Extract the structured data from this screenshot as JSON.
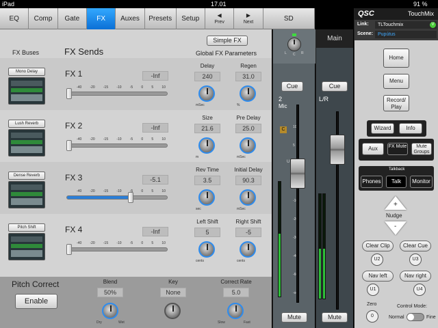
{
  "status": {
    "device": "iPad",
    "time": "17.01",
    "battery": "91 %"
  },
  "tabs": [
    {
      "label": "EQ"
    },
    {
      "label": "Comp"
    },
    {
      "label": "Gate"
    },
    {
      "label": "FX"
    },
    {
      "label": "Auxes"
    },
    {
      "label": "Presets"
    },
    {
      "label": "Setup"
    },
    {
      "label": "Prev"
    },
    {
      "label": "Next"
    },
    {
      "label": "SD"
    }
  ],
  "fx": {
    "buses_label": "FX Buses",
    "title": "FX Sends",
    "simple_fx_label": "Simple FX",
    "global_params_label": "Global FX Parameters",
    "scale": [
      "-40",
      "-20",
      "-15",
      "-10",
      "-5",
      "0",
      "5",
      "10"
    ],
    "rows": [
      {
        "name": "FX 1",
        "preset": "Mono Delay",
        "send": "-Inf",
        "send_level": 0.0,
        "p1_label": "Delay",
        "p1_value": "240",
        "p1_unit": "mSec",
        "p2_label": "Regen",
        "p2_value": "31.0",
        "p2_unit": "%"
      },
      {
        "name": "FX 2",
        "preset": "Lush Reverb",
        "send": "-Inf",
        "send_level": 0.0,
        "p1_label": "Size",
        "p1_value": "21.6",
        "p1_unit": "m",
        "p2_label": "Pre Delay",
        "p2_value": "25.0",
        "p2_unit": "mSec"
      },
      {
        "name": "FX 3",
        "preset": "Dense Reverb",
        "send": "-5.1",
        "send_level": 0.64,
        "p1_label": "Rev Time",
        "p1_value": "3.5",
        "p1_unit": "sec",
        "p2_label": "Initial Delay",
        "p2_value": "90.3",
        "p2_unit": "mSec"
      },
      {
        "name": "FX 4",
        "preset": "Pitch Shift",
        "send": "-Inf",
        "send_level": 0.0,
        "p1_label": "Left Shift",
        "p1_value": "5",
        "p1_unit": "cents",
        "p2_label": "Right Shift",
        "p2_value": "-5",
        "p2_unit": "cents"
      }
    ]
  },
  "pitch": {
    "title": "Pitch Correct",
    "enable_label": "Enable",
    "blend_label": "Blend",
    "blend_value": "50%",
    "blend_min": "Dry",
    "blend_max": "Wet",
    "key_label": "Key",
    "key_value": "None",
    "rate_label": "Correct Rate",
    "rate_value": "5.0",
    "rate_min": "Slow",
    "rate_max": "Fast"
  },
  "channel": {
    "number": "2",
    "name": "Mic",
    "pan_left": "L",
    "pan_center": "C",
    "pan_right": "R",
    "cue_label": "Cue",
    "clip_label": "C",
    "unity_label": "U",
    "mute_label": "Mute",
    "scale": [
      "10",
      "5",
      "0",
      "-5",
      "-10",
      "-20",
      "-30",
      "-40",
      "-60",
      "-oo"
    ],
    "meter_level": 0.55,
    "fader_level": 0.68
  },
  "main": {
    "title": "Main",
    "name": "L/R",
    "cue_label": "Cue",
    "mute_label": "Mute",
    "meter_level": 0.48,
    "fader_level": 0.86
  },
  "right": {
    "brand": "QSC",
    "product": "TouchMix",
    "link_label": "Link:",
    "link_value": "TLTouchmix",
    "link_badge": "V",
    "scene_label": "Scene:",
    "scene_value": "Pupútus",
    "home": "Home",
    "menu": "Menu",
    "record_play": "Record/ Play",
    "wizard": "Wizard",
    "info": "Info",
    "aux": "Aux",
    "fx_mute": "FX Mute",
    "mute_groups": "Mute Groups",
    "talkback": "Talkback",
    "phones": "Phones",
    "talk": "Talk",
    "monitor": "Monitor",
    "nudge": "Nudge",
    "nudge_up": "+",
    "nudge_down": "-",
    "clear_clip": "Clear Clip",
    "clear_cue": "Clear Cue",
    "u2": "U2",
    "u3": "U3",
    "nav_left": "Nav left",
    "nav_right": "Nav right",
    "u1": "U1",
    "u4": "U4",
    "zero": "Zero",
    "zero_btn": "0",
    "control_mode": "Control Mode:",
    "normal": "Normal",
    "fine": "Fine"
  },
  "colors": {
    "accent": "#1a8cf0",
    "meter": "#2fbf3a",
    "active_tab": "#1e86e8"
  }
}
